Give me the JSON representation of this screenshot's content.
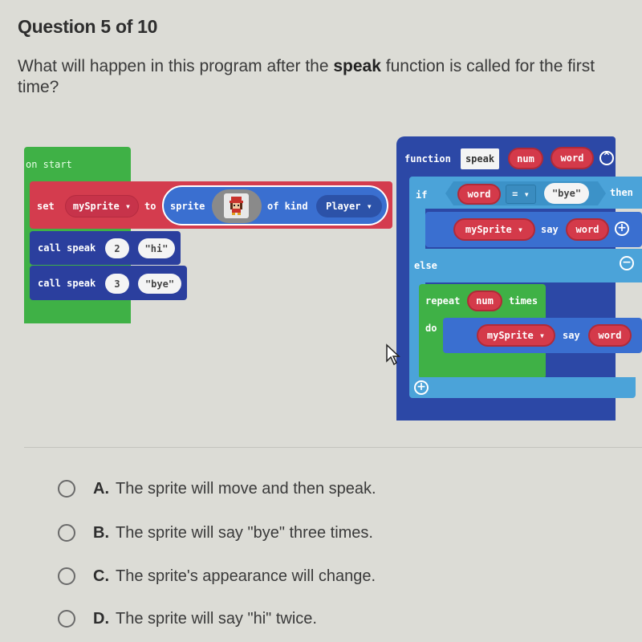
{
  "question": {
    "number_label": "Question 5 of 10",
    "prompt_before": "What will happen in this program after the ",
    "prompt_bold": "speak",
    "prompt_after": " function is called for the first time?"
  },
  "program": {
    "on_start": {
      "label": "on start",
      "set_block": {
        "set_label": "set",
        "variable": "mySprite",
        "to_label": "to",
        "sprite_label": "sprite",
        "image": "sprite-image",
        "of_kind_label": "of kind",
        "kind": "Player"
      },
      "calls": [
        {
          "label": "call speak",
          "num": "2",
          "word": "\"hi\""
        },
        {
          "label": "call speak",
          "num": "3",
          "word": "\"bye\""
        }
      ]
    },
    "function_block": {
      "function_label": "function",
      "name": "speak",
      "params": [
        "num",
        "word"
      ],
      "if_label": "if",
      "condition_left": "word",
      "operator": "=",
      "condition_right": "\"bye\"",
      "then_label": "then",
      "if_body": {
        "sprite": "mySprite",
        "say_label": "say",
        "arg": "word"
      },
      "else_label": "else",
      "repeat_label": "repeat",
      "repeat_count": "num",
      "times_label": "times",
      "do_label": "do",
      "repeat_body": {
        "sprite": "mySprite",
        "say_label": "say",
        "arg": "word"
      }
    }
  },
  "options": [
    {
      "letter": "A.",
      "text": "The sprite will move and then speak."
    },
    {
      "letter": "B.",
      "text": "The sprite will say \"bye\" three times."
    },
    {
      "letter": "C.",
      "text": "The sprite's appearance will change."
    },
    {
      "letter": "D.",
      "text": "The sprite will say \"hi\" twice."
    }
  ]
}
